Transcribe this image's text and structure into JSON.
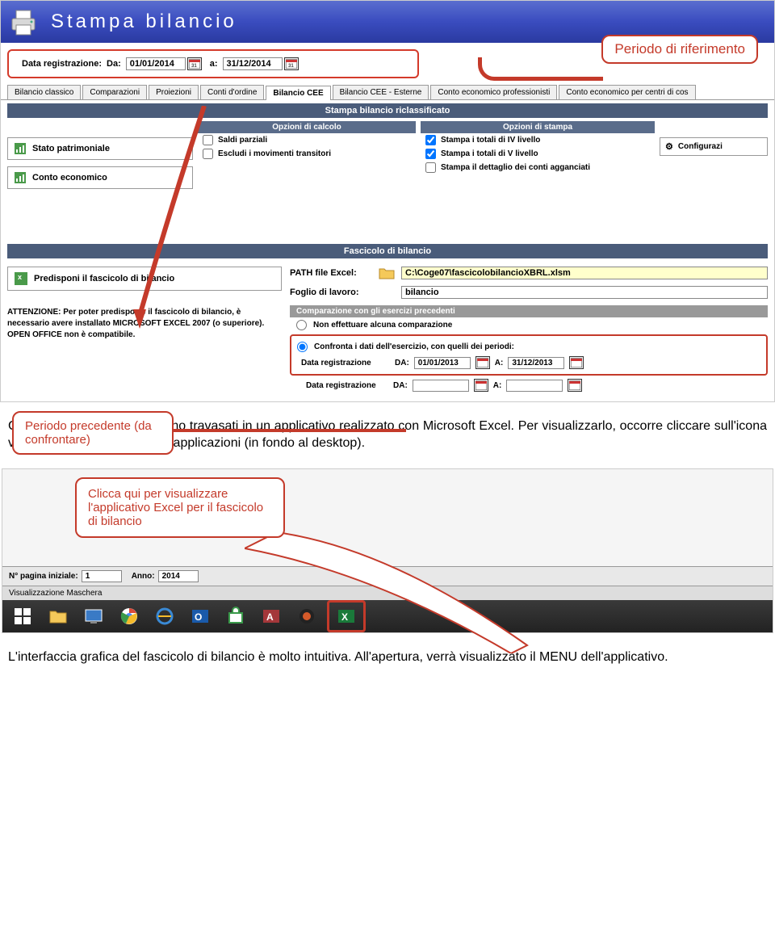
{
  "titlebar": {
    "text": "Stampa  bilancio"
  },
  "date_row": {
    "label_reg": "Data registrazione:",
    "label_da": "Da:",
    "value_da": "01/01/2014",
    "label_a": "a:",
    "value_a": "31/12/2014"
  },
  "callout_periodo_rif": "Periodo di riferimento",
  "callout_prec": "Periodo precedente (da confrontare)",
  "tabs": {
    "t0": "Bilancio classico",
    "t1": "Comparazioni",
    "t2": "Proiezioni",
    "t3": "Conti d'ordine",
    "t4": "Bilancio CEE",
    "t5": "Bilancio CEE - Esterne",
    "t6": "Conto economico professionisti",
    "t7": "Conto economico per centri di cos"
  },
  "stampa": {
    "header": "Stampa bilancio riclassificato",
    "opz_calcolo_h": "Opzioni di calcolo",
    "opz_stampa_h": "Opzioni di stampa",
    "btn_stato": "Stato patrimoniale",
    "btn_conto": "Conto economico",
    "chk_saldi": "Saldi parziali",
    "chk_escludi": "Escludi i movimenti transitori",
    "chk_iv": "Stampa i totali di IV livello",
    "chk_v": "Stampa i totali di V livello",
    "chk_dett": "Stampa il dettaglio dei conti agganciati",
    "config": "Configurazi"
  },
  "fascicolo": {
    "header": "Fascicolo di bilancio",
    "predisponi": "Predisponi il fascicolo di bilancio",
    "att_l1": "ATTENZIONE: Per poter predisporre il fascicolo di bilancio, è",
    "att_l2": "necessario avere installato MICROSOFT EXCEL 2007 (o superiore).",
    "att_l3": "OPEN OFFICE non è compatibile.",
    "path_lbl": "PATH file Excel:",
    "path_val": "C:\\Coge07\\fascicolobilancioXBRL.xlsm",
    "foglio_lbl": "Foglio di lavoro:",
    "foglio_val": "bilancio",
    "compare_h": "Comparazione con gli esercizi precedenti",
    "radio_no": "Non effettuare alcuna comparazione",
    "radio_yes": "Confronta i dati dell'esercizio, con quelli dei periodi:",
    "dr_lbl": "Data registrazione",
    "da_lbl": "DA:",
    "a_lbl": "A:",
    "cmp_da1": "01/01/2013",
    "cmp_a1": "31/12/2013",
    "cmp_da2": "",
    "cmp_a2": ""
  },
  "para1": "Così, i dati di bilancio verranno travasati in un applicativo realizzato con Microsoft Excel. Per visualizzarlo, occorre cliccare sull'icona visualizzata sulla barra delle applicazioni (in fondo al desktop).",
  "callout_excel": "Clicca qui per visualizzare l'applicativo Excel per il fascicolo di bilancio",
  "bottom_bar": {
    "pag_lbl": "N° pagina iniziale:",
    "pag_val": "1",
    "anno_lbl": "Anno:",
    "anno_val": "2014"
  },
  "statusbar": "Visualizzazione Maschera",
  "para2": "L'interfaccia grafica del fascicolo di bilancio è molto intuitiva. All'apertura, verrà visualizzato il MENU dell'applicativo."
}
